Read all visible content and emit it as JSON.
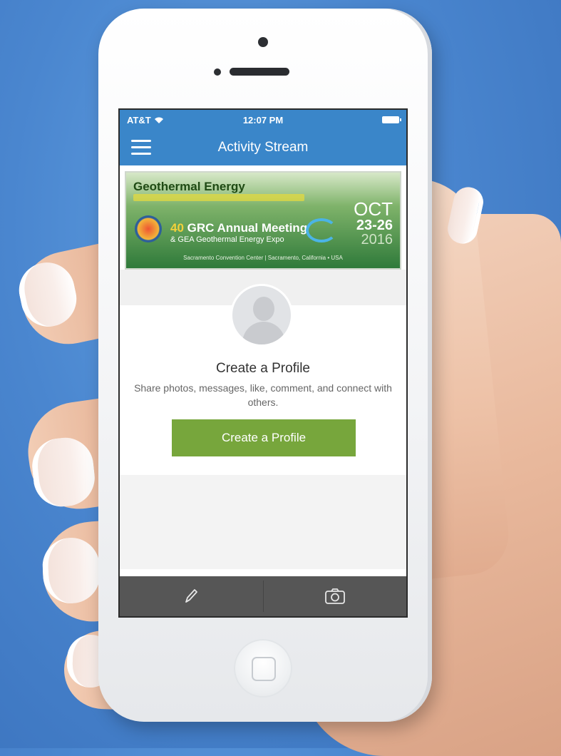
{
  "status_bar": {
    "carrier": "AT&T",
    "time": "12:07 PM"
  },
  "nav": {
    "title": "Activity Stream"
  },
  "banner": {
    "title": "Geothermal Energy",
    "meeting_number": "40",
    "meeting_text": "GRC Annual Meeting",
    "expo_text": "& GEA Geothermal Energy Expo",
    "month": "OCT",
    "days": "23-26",
    "year": "2016",
    "venue": "Sacramento Convention Center | Sacramento, California • USA"
  },
  "profile": {
    "title": "Create a Profile",
    "description": "Share photos, messages, like, comment, and connect with others.",
    "button_label": "Create a Profile"
  },
  "bottom_bar": {
    "icons": [
      "pencil-icon",
      "camera-icon"
    ]
  },
  "colors": {
    "nav_blue": "#3a86c9",
    "button_green": "#77a63c",
    "bottom_bar": "#565656"
  }
}
